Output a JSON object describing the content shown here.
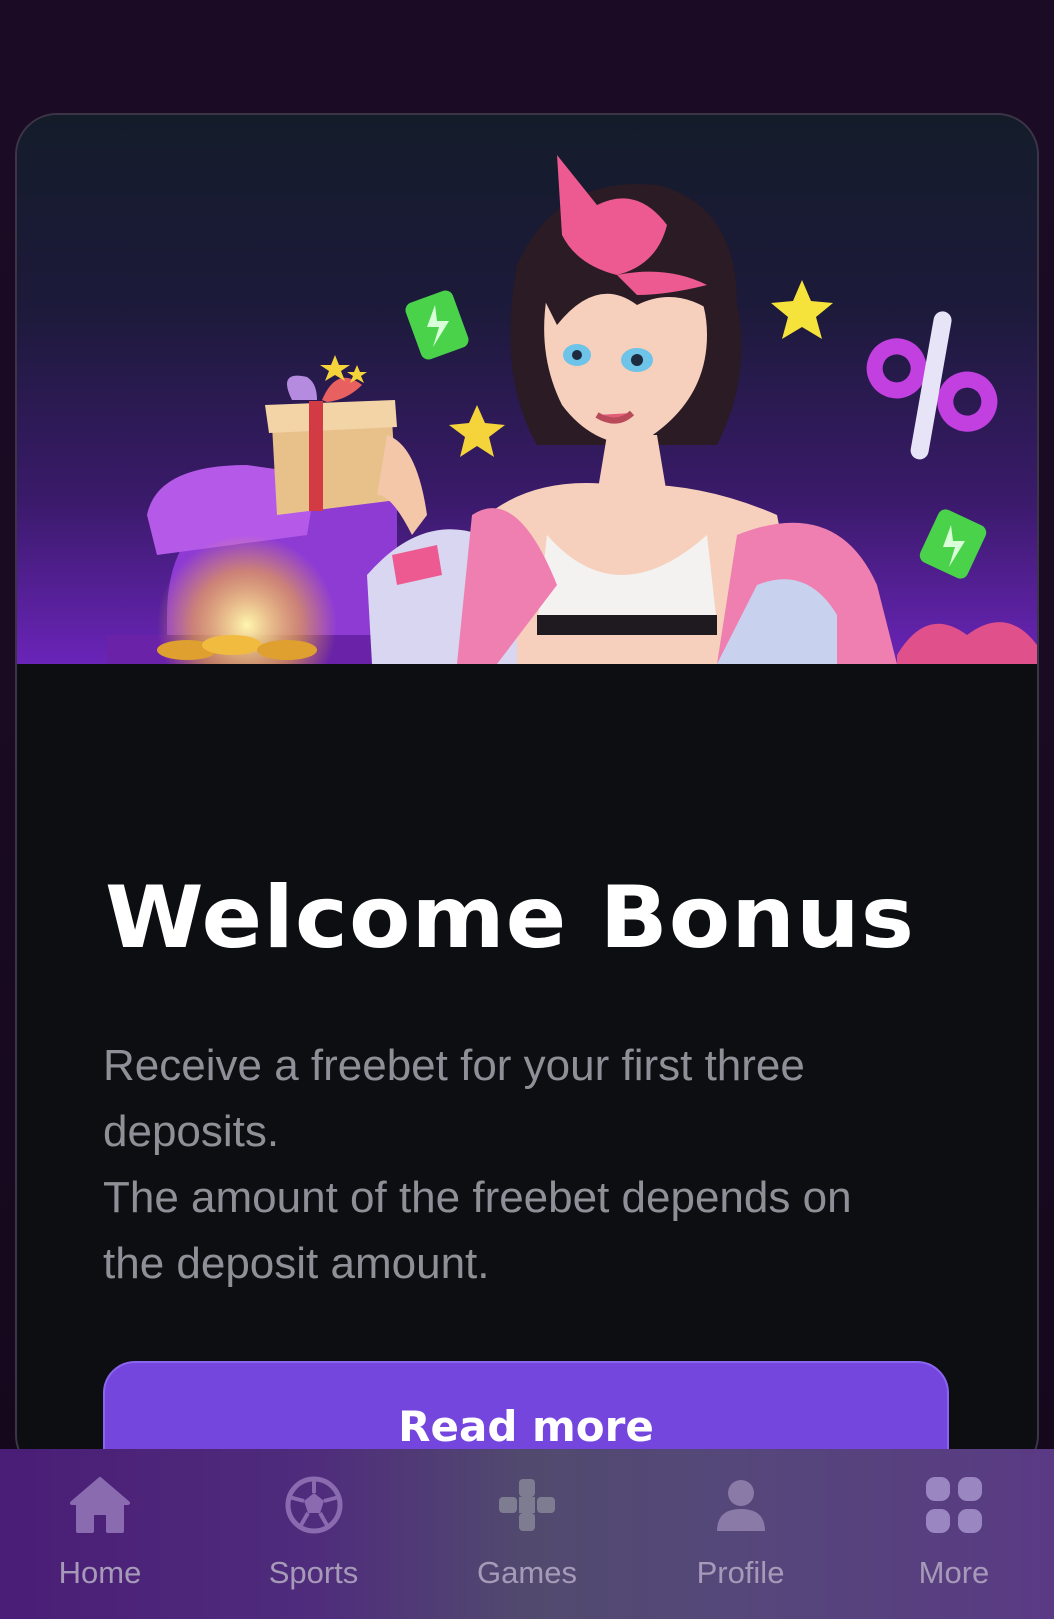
{
  "promo": {
    "title": "Welcome Bonus",
    "description_lines": [
      "Receive a freebet for your first three",
      "deposits.",
      "The amount of the freebet depends on",
      "the deposit amount."
    ],
    "button_label": "Read more",
    "hero_icons": [
      "gift-box-icon",
      "treasure-chest-icon",
      "star-icon",
      "percent-icon",
      "lightning-ticket-icon"
    ]
  },
  "nav": {
    "items": [
      {
        "label": "Home",
        "icon": "home-icon"
      },
      {
        "label": "Sports",
        "icon": "soccer-ball-icon"
      },
      {
        "label": "Games",
        "icon": "gamepad-icon"
      },
      {
        "label": "Profile",
        "icon": "user-icon"
      },
      {
        "label": "More",
        "icon": "grid-icon"
      }
    ]
  },
  "colors": {
    "page_background": "#1c0b24",
    "card_background": "#0d0e12",
    "accent": "#7446de",
    "title": "#ffffff",
    "description": "#8f9097",
    "nav_label": "#a69ab8"
  }
}
